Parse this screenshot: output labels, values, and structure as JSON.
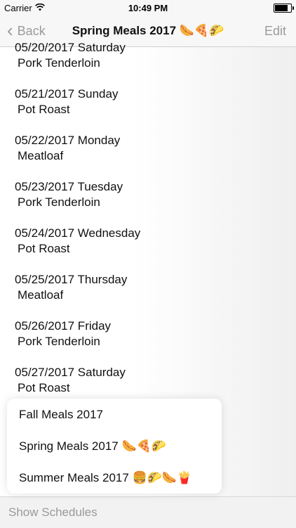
{
  "status_bar": {
    "carrier": "Carrier",
    "wifi_icon": "wifi-icon",
    "time": "10:49 PM",
    "battery_icon": "battery-icon"
  },
  "nav": {
    "back_label": "Back",
    "title": "Spring Meals 2017 🌭🍕🌮",
    "edit_label": "Edit"
  },
  "meals": [
    {
      "date": "05/20/2017 Saturday",
      "meal": "Pork Tenderloin"
    },
    {
      "date": "05/21/2017 Sunday",
      "meal": "Pot Roast"
    },
    {
      "date": "05/22/2017 Monday",
      "meal": "Meatloaf"
    },
    {
      "date": "05/23/2017 Tuesday",
      "meal": "Pork Tenderloin"
    },
    {
      "date": "05/24/2017 Wednesday",
      "meal": "Pot Roast"
    },
    {
      "date": "05/25/2017 Thursday",
      "meal": "Meatloaf"
    },
    {
      "date": "05/26/2017 Friday",
      "meal": "Pork Tenderloin"
    },
    {
      "date": "05/27/2017 Saturday",
      "meal": "Pot Roast"
    }
  ],
  "schedules": [
    "Fall Meals 2017",
    "Spring Meals 2017 🌭🍕🌮",
    "Summer Meals 2017 🍔🌮🌭🍟"
  ],
  "toolbar": {
    "show_schedules_label": "Show Schedules"
  }
}
